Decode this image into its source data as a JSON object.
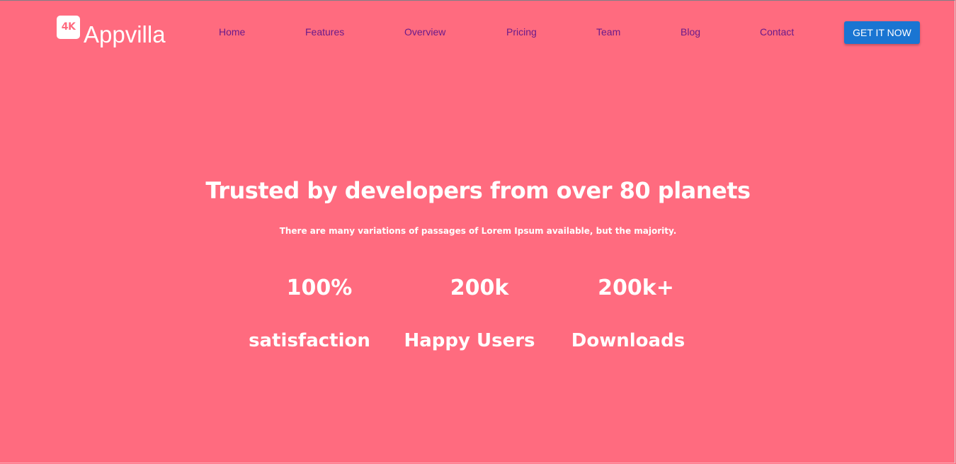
{
  "brand": {
    "badge": "4K",
    "name": "Appvilla"
  },
  "nav": {
    "items": [
      "Home",
      "Features",
      "Overview",
      "Pricing",
      "Team",
      "Blog",
      "Contact"
    ],
    "cta": "GET IT NOW"
  },
  "hero": {
    "title": "Trusted by developers from over 80 planets",
    "subtitle": "There are many variations of passages of Lorem Ipsum available, but the majority."
  },
  "stats": [
    {
      "value": "100%",
      "label": "satisfaction"
    },
    {
      "value": "200k",
      "label": "Happy Users"
    },
    {
      "value": "200k+",
      "label": "Downloads"
    }
  ],
  "colors": {
    "background": "#ff6b7f",
    "nav_link": "#6a1b8a",
    "cta": "#1a75d2",
    "text": "#ffffff"
  }
}
